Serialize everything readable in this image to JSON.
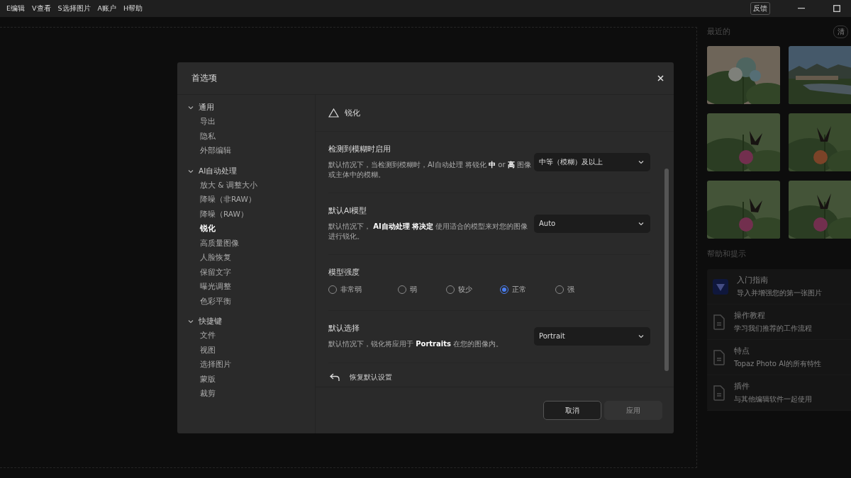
{
  "menu": [
    "E编辑",
    "V查看",
    "S选择图片",
    "A账户",
    "H帮助"
  ],
  "titlebar": {
    "feedback": "反馈"
  },
  "recent": {
    "title": "最近的",
    "clear": "清"
  },
  "help": {
    "title": "帮助和提示",
    "items": [
      {
        "kind": "logo",
        "title": "入门指南",
        "subtitle": "导入并增强您的第一张图片"
      },
      {
        "kind": "doc",
        "title": "操作教程",
        "subtitle": "学习我们推荐的工作流程"
      },
      {
        "kind": "doc",
        "title": "特点",
        "subtitle": "Topaz Photo AI的所有特性"
      },
      {
        "kind": "doc",
        "title": "插件",
        "subtitle": "与其他编辑软件一起使用"
      }
    ]
  },
  "dialog": {
    "title": "首选项",
    "nav": [
      {
        "label": "通用",
        "expanded": true,
        "children": [
          {
            "label": "导出",
            "selected": false
          },
          {
            "label": "隐私",
            "selected": false
          },
          {
            "label": "外部编辑",
            "selected": false
          }
        ]
      },
      {
        "label": "AI自动处理",
        "expanded": true,
        "children": [
          {
            "label": "放大 & 调整大小",
            "selected": false
          },
          {
            "label": "降噪（非RAW）",
            "selected": false
          },
          {
            "label": "降噪（RAW）",
            "selected": false
          },
          {
            "label": "锐化",
            "selected": true
          },
          {
            "label": "高质量图像",
            "selected": false
          },
          {
            "label": "人脸恢复",
            "selected": false
          },
          {
            "label": "保留文字",
            "selected": false
          },
          {
            "label": "曝光调整",
            "selected": false
          },
          {
            "label": "色彩平衡",
            "selected": false
          }
        ]
      },
      {
        "label": "快捷键",
        "expanded": true,
        "children": [
          {
            "label": "文件",
            "selected": false
          },
          {
            "label": "视图",
            "selected": false
          },
          {
            "label": "选择图片",
            "selected": false
          },
          {
            "label": "蒙版",
            "selected": false
          },
          {
            "label": "裁剪",
            "selected": false
          }
        ]
      }
    ],
    "section_title": "锐化",
    "settings": [
      {
        "kind": "dropdown",
        "title": "检测到模糊时启用",
        "description": "默认情况下，当检测到模糊时，AI自动处理 将锐化 **中** or **高** 图像或主体中的模糊。",
        "value": "中等（模糊）及以上"
      },
      {
        "kind": "dropdown",
        "title": "默认AI模型",
        "description": "默认情况下， **AI自动处理 将决定** 使用适合的模型来对您的图像进行锐化。",
        "value": "Auto"
      },
      {
        "kind": "radio",
        "title": "模型强度",
        "options": [
          {
            "label": "非常弱",
            "selected": false
          },
          {
            "label": "弱",
            "selected": false
          },
          {
            "label": "较少",
            "selected": false
          },
          {
            "label": "正常",
            "selected": true
          },
          {
            "label": "强",
            "selected": false
          }
        ]
      },
      {
        "kind": "dropdown",
        "title": "默认选择",
        "description": "默认情况下，锐化将应用于 **Portraits** 在您的图像内。",
        "value": "Portrait"
      }
    ],
    "reset": "恢复默认设置",
    "buttons": [
      {
        "label": "取消",
        "kind": "secondary",
        "disabled": false
      },
      {
        "label": "应用",
        "kind": "primary",
        "disabled": true
      }
    ]
  }
}
